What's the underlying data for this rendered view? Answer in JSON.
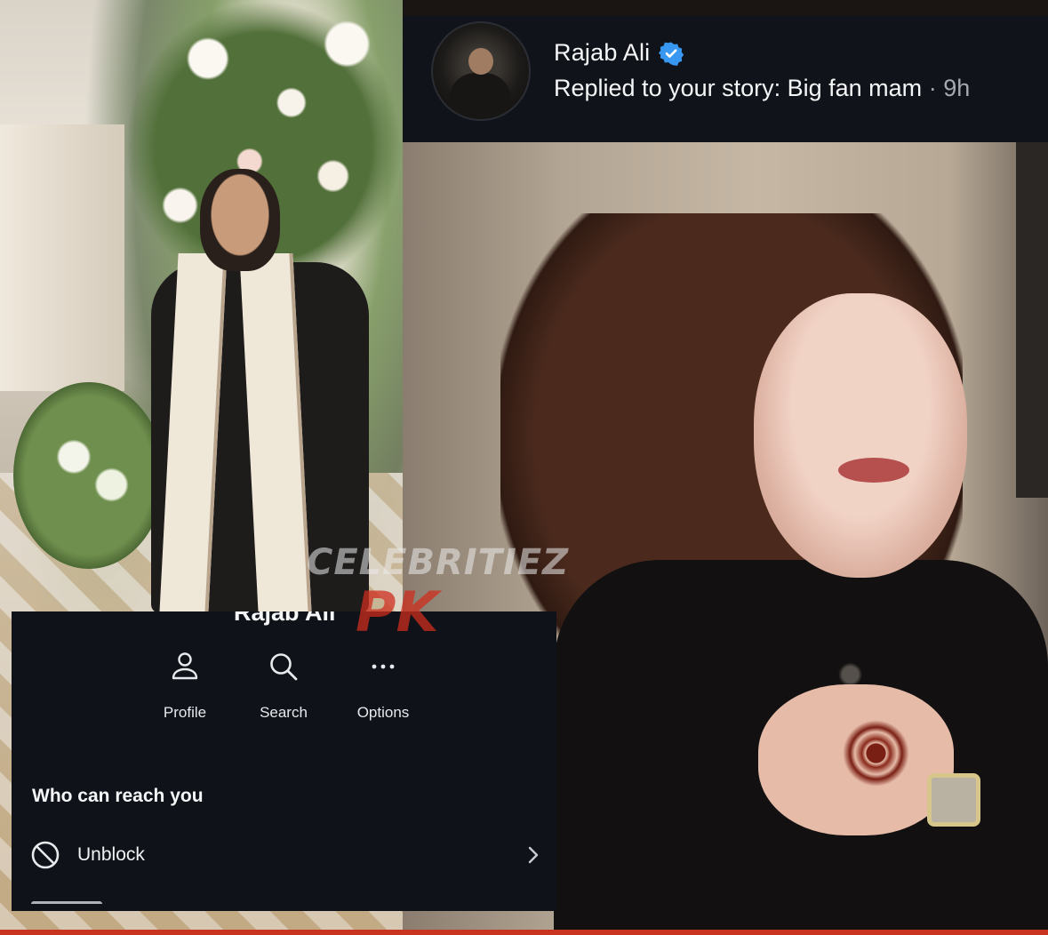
{
  "notification": {
    "username": "Rajab Ali",
    "verified": true,
    "message": "Replied to your story: Big fan mam",
    "separator": " · ",
    "time": "9h"
  },
  "menu": {
    "header_partial": "Rajab Ali",
    "actions": [
      {
        "label": "Profile",
        "icon": "person-icon"
      },
      {
        "label": "Search",
        "icon": "search-icon"
      },
      {
        "label": "Options",
        "icon": "more-icon"
      }
    ],
    "section_title": "Who can reach you",
    "unblock_label": "Unblock"
  },
  "watermark": {
    "line1": "CELEBRITIEZ",
    "line2": "PK"
  },
  "colors": {
    "panel_bg": "#0f1319",
    "verified_blue": "#3897f0",
    "accent_red": "#c8341f"
  }
}
